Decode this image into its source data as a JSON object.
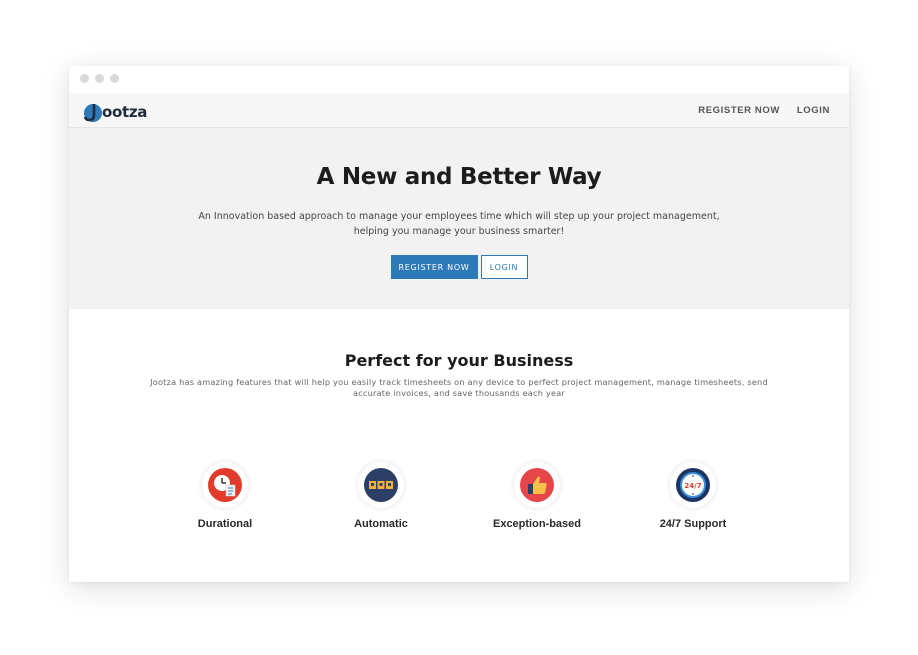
{
  "brand": {
    "logo_initial": "J",
    "logo_text": "ootza",
    "accent_color": "#2e79b8"
  },
  "nav": {
    "register_label": "REGISTER NOW",
    "login_label": "LOGIN"
  },
  "hero": {
    "title": "A New and Better Way",
    "subtitle_line1": "An Innovation based approach to manage your employees time which will step up your project management,",
    "subtitle_line2": "helping you manage your business smarter!",
    "register_label": "REGISTER NOW",
    "login_label": "LOGIN"
  },
  "features": {
    "title": "Perfect for your Business",
    "subtitle_line1": "Jootza has amazing features that will help you easily track timesheets on any device to perfect project management, manage timesheets, send",
    "subtitle_line2": "accurate invoices, and save thousands each year",
    "items": [
      {
        "label": "Durational",
        "icon": "clock-document-icon"
      },
      {
        "label": "Automatic",
        "icon": "automation-icon"
      },
      {
        "label": "Exception-based",
        "icon": "thumbs-up-icon"
      },
      {
        "label": "24/7 Support",
        "icon": "support-clock-icon"
      }
    ]
  }
}
